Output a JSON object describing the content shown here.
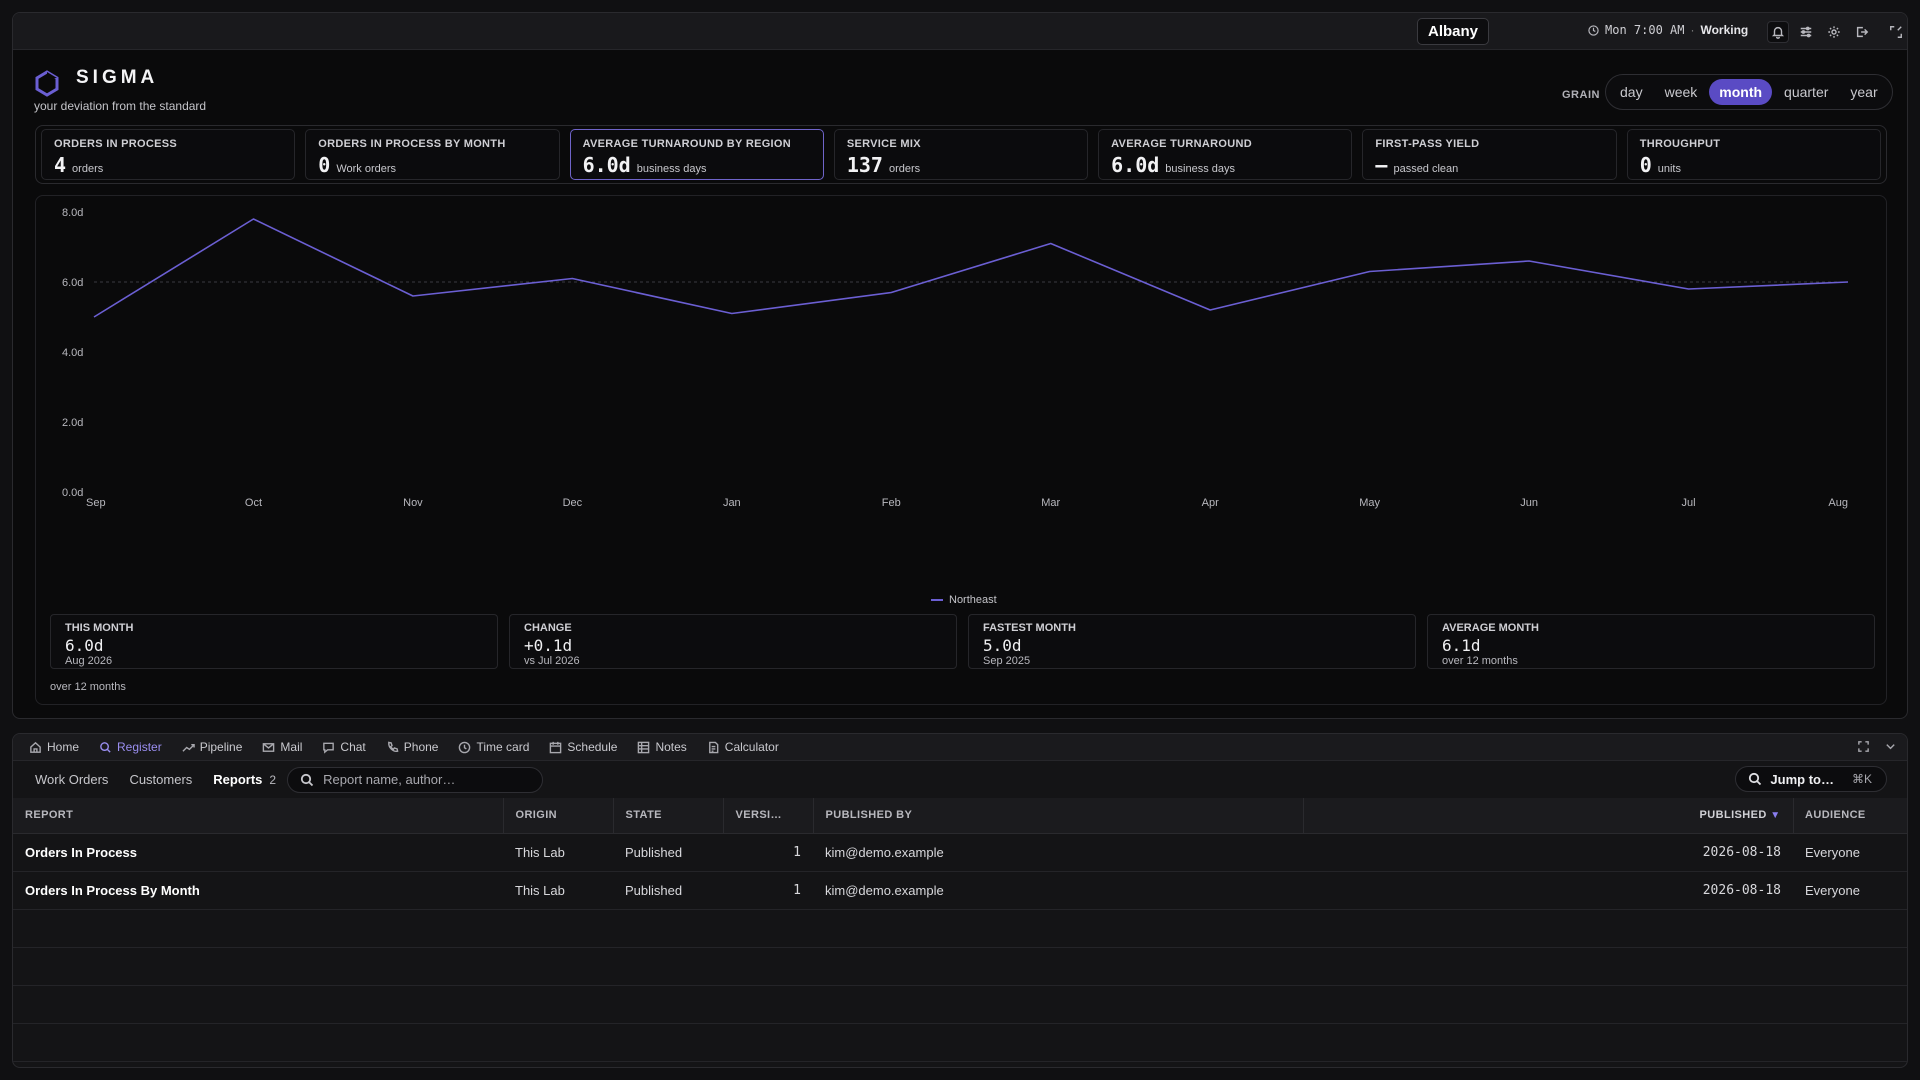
{
  "topbar": {
    "location": "Albany",
    "time": "Mon 7:00 AM",
    "separator": "·",
    "status": "Working",
    "icons": [
      "bell-icon",
      "sliders-icon",
      "gear-icon",
      "logout-icon",
      "fullscreen-icon"
    ]
  },
  "brand": {
    "title": "SIGMA",
    "subtitle": "your deviation from the standard",
    "accent": "#5a4bc4"
  },
  "grain": {
    "label": "GRAIN",
    "options": [
      "day",
      "week",
      "month",
      "quarter",
      "year"
    ],
    "selected": "month"
  },
  "kpis": [
    {
      "label": "ORDERS IN PROCESS",
      "value": "4",
      "unit": "orders"
    },
    {
      "label": "ORDERS IN PROCESS BY MONTH",
      "value": "0",
      "unit": "Work orders"
    },
    {
      "label": "AVERAGE TURNAROUND BY REGION",
      "value": "6.0d",
      "unit": "business days",
      "selected": true
    },
    {
      "label": "SERVICE MIX",
      "value": "137",
      "unit": "orders"
    },
    {
      "label": "AVERAGE TURNAROUND",
      "value": "6.0d",
      "unit": "business days"
    },
    {
      "label": "FIRST-PASS YIELD",
      "value": "—",
      "unit": "passed clean"
    },
    {
      "label": "THROUGHPUT",
      "value": "0",
      "unit": "units"
    }
  ],
  "chart_data": {
    "type": "line",
    "categories": [
      "Sep",
      "Oct",
      "Nov",
      "Dec",
      "Jan",
      "Feb",
      "Mar",
      "Apr",
      "May",
      "Jun",
      "Jul",
      "Aug"
    ],
    "series": [
      {
        "name": "Northeast",
        "values": [
          5.0,
          7.8,
          5.6,
          6.1,
          5.1,
          5.7,
          7.1,
          5.2,
          6.3,
          6.6,
          5.8,
          6.0
        ],
        "color": "#6b5fd3"
      }
    ],
    "yticks": [
      "0.0d",
      "2.0d",
      "4.0d",
      "6.0d",
      "8.0d"
    ],
    "ylim": [
      0,
      8
    ],
    "reference_line": 6.0,
    "legend_position": "bottom-center"
  },
  "stats": [
    {
      "label": "THIS MONTH",
      "value": "6.0d",
      "sub": "Aug 2026"
    },
    {
      "label": "CHANGE",
      "value": "+0.1d",
      "sub": "vs Jul 2026"
    },
    {
      "label": "FASTEST MONTH",
      "value": "5.0d",
      "sub": "Sep 2025"
    },
    {
      "label": "AVERAGE MONTH",
      "value": "6.1d",
      "sub": "over 12 months"
    }
  ],
  "over_note": "over 12 months",
  "nav": {
    "items": [
      {
        "label": "Home",
        "icon": "home-icon"
      },
      {
        "label": "Register",
        "icon": "search-icon",
        "active": true
      },
      {
        "label": "Pipeline",
        "icon": "trend-icon"
      },
      {
        "label": "Mail",
        "icon": "mail-icon"
      },
      {
        "label": "Chat",
        "icon": "chat-icon"
      },
      {
        "label": "Phone",
        "icon": "phone-icon"
      },
      {
        "label": "Time card",
        "icon": "clock-icon"
      },
      {
        "label": "Schedule",
        "icon": "calendar-icon"
      },
      {
        "label": "Notes",
        "icon": "grid-icon"
      },
      {
        "label": "Calculator",
        "icon": "calculator-icon"
      }
    ]
  },
  "subtabs": {
    "items": [
      "Work Orders",
      "Customers",
      "Reports"
    ],
    "selected": "Reports",
    "count": "2",
    "search_placeholder": "Report name, author…",
    "jump_label": "Jump to…",
    "jump_shortcut": "⌘K"
  },
  "table": {
    "columns": [
      "REPORT",
      "ORIGIN",
      "STATE",
      "VERSI…",
      "PUBLISHED BY",
      "",
      "PUBLISHED",
      "AUDIENCE"
    ],
    "rows": [
      {
        "report": "Orders In Process",
        "origin": "This Lab",
        "state": "Published",
        "version": "1",
        "published_by": "kim@demo.example",
        "published": "2026-08-18",
        "audience": "Everyone"
      },
      {
        "report": "Orders In Process By Month",
        "origin": "This Lab",
        "state": "Published",
        "version": "1",
        "published_by": "kim@demo.example",
        "published": "2026-08-18",
        "audience": "Everyone"
      }
    ]
  }
}
